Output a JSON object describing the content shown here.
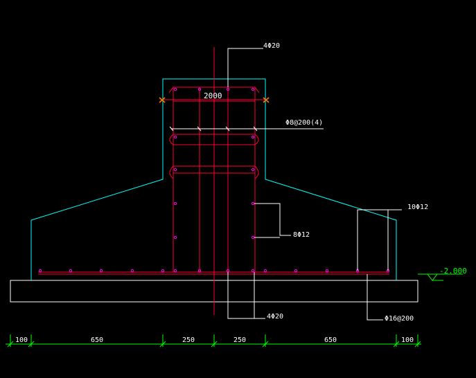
{
  "drawing": {
    "colors": {
      "background": "#000000",
      "concrete_outline": "#00ffff",
      "rebar": "#ff0033",
      "rebar_dot": "#ff00ff",
      "leader": "#ffffff",
      "dimension": "#00ff00",
      "center_line": "#ff0033",
      "marker": "#ff8000"
    },
    "labels": {
      "top_bars": "4Φ20",
      "bottom_bars": "4Φ20",
      "stirrup": "Φ8@200(4)",
      "side_bars": "8Φ12",
      "footing_bars": "10Φ12",
      "bottom_mesh": "Φ16@200",
      "section_width": "2000",
      "elevation": "-2.000"
    },
    "dimensions": [
      "100",
      "650",
      "250",
      "250",
      "650",
      "100"
    ]
  }
}
